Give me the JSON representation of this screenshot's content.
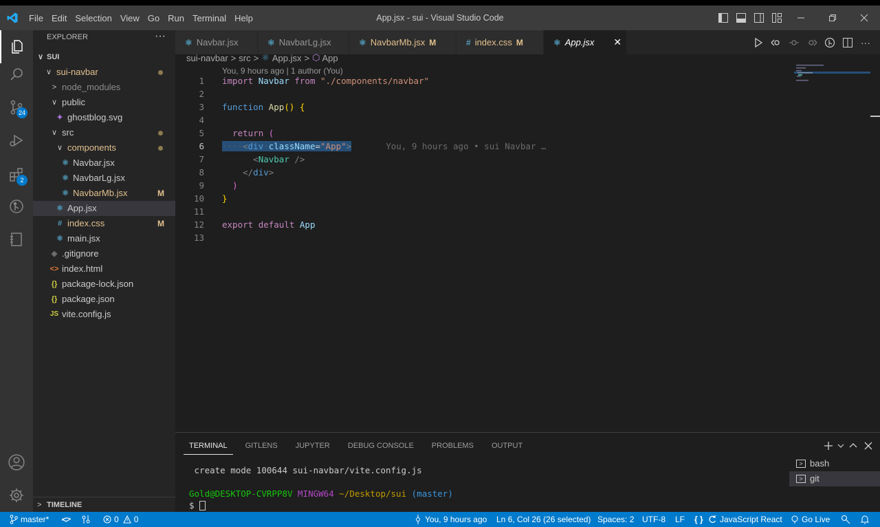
{
  "window": {
    "title": "App.jsx - sui - Visual Studio Code",
    "menu": [
      "File",
      "Edit",
      "Selection",
      "View",
      "Go",
      "Run",
      "Terminal",
      "Help"
    ]
  },
  "activity": {
    "source_control_badge": "24",
    "extensions_badge": "2"
  },
  "explorer": {
    "title": "EXPLORER",
    "more": "···",
    "root": "SUI",
    "timeline": "TIMELINE",
    "items": [
      {
        "label": "sui-navbar",
        "status": "dot"
      },
      {
        "label": "node_modules"
      },
      {
        "label": "public"
      },
      {
        "label": "ghostblog.svg"
      },
      {
        "label": "src",
        "status": "dot"
      },
      {
        "label": "components",
        "status": "dot"
      },
      {
        "label": "Navbar.jsx"
      },
      {
        "label": "NavbarLg.jsx"
      },
      {
        "label": "NavbarMb.jsx",
        "status": "M"
      },
      {
        "label": "App.jsx"
      },
      {
        "label": "index.css",
        "status": "M"
      },
      {
        "label": "main.jsx"
      },
      {
        "label": ".gitignore"
      },
      {
        "label": "index.html"
      },
      {
        "label": "package-lock.json"
      },
      {
        "label": "package.json"
      },
      {
        "label": "vite.config.js"
      }
    ]
  },
  "tabs": [
    {
      "label": "Navbar.jsx",
      "icon": "react-icon"
    },
    {
      "label": "NavbarLg.jsx",
      "icon": "react-icon"
    },
    {
      "label": "NavbarMb.jsx",
      "status": "M",
      "icon": "react-icon"
    },
    {
      "label": "index.css",
      "status": "M",
      "icon": "hash-icon"
    },
    {
      "label": "App.jsx",
      "active": true,
      "icon": "react-icon"
    }
  ],
  "breadcrumb": [
    "sui-navbar",
    "src",
    "App.jsx",
    "App"
  ],
  "editor": {
    "codelens": "You, 9 hours ago | 1 author (You)",
    "line_numbers": [
      "1",
      "2",
      "3",
      "4",
      "5",
      "6",
      "7",
      "8",
      "9",
      "10",
      "11",
      "12",
      "13"
    ],
    "current_line": "6",
    "code": {
      "l1_import": "import",
      "l1_name": "Navbar",
      "l1_from": "from",
      "l1_path": "\"./components/navbar\"",
      "l3_function": "function",
      "l3_name": "App",
      "l3_rest": "() {",
      "l5_return": "return",
      "l5_paren": "(",
      "l6_dots": "····",
      "l6_tag": "div",
      "l6_attr": "className",
      "l6_val": "\"App\"",
      "l6_blame": "You, 9 hours ago • sui Navbar …",
      "l7_comp": "Navbar",
      "l8_tag": "div",
      "l9_paren": ")",
      "l10_brace": "}",
      "l12_export": "export",
      "l12_default": "default",
      "l12_name": "App"
    }
  },
  "panel": {
    "tabs": [
      "TERMINAL",
      "GITLENS",
      "JUPYTER",
      "DEBUG CONSOLE",
      "PROBLEMS",
      "OUTPUT"
    ],
    "terminal": {
      "line1": " create mode 100644 sui-navbar/vite.config.js",
      "prompt_user": "Gold@DESKTOP-CVRPP8V",
      "prompt_env": "MINGW64",
      "prompt_path": "~/Desktop/sui",
      "prompt_branch": "(master)",
      "prompt_symbol": "$"
    },
    "sessions": [
      "bash",
      "git"
    ]
  },
  "statusbar": {
    "branch": "master*",
    "errors": "0",
    "warnings": "0",
    "blame": "You, 9 hours ago",
    "position": "Ln 6, Col 26 (26 selected)",
    "spaces": "Spaces: 2",
    "encoding": "UTF-8",
    "eol": "LF",
    "language": "JavaScript React",
    "golive": "Go Live"
  },
  "colors": {
    "accent": "#007acc",
    "modified": "#e2c08d",
    "react": "#519aba"
  }
}
